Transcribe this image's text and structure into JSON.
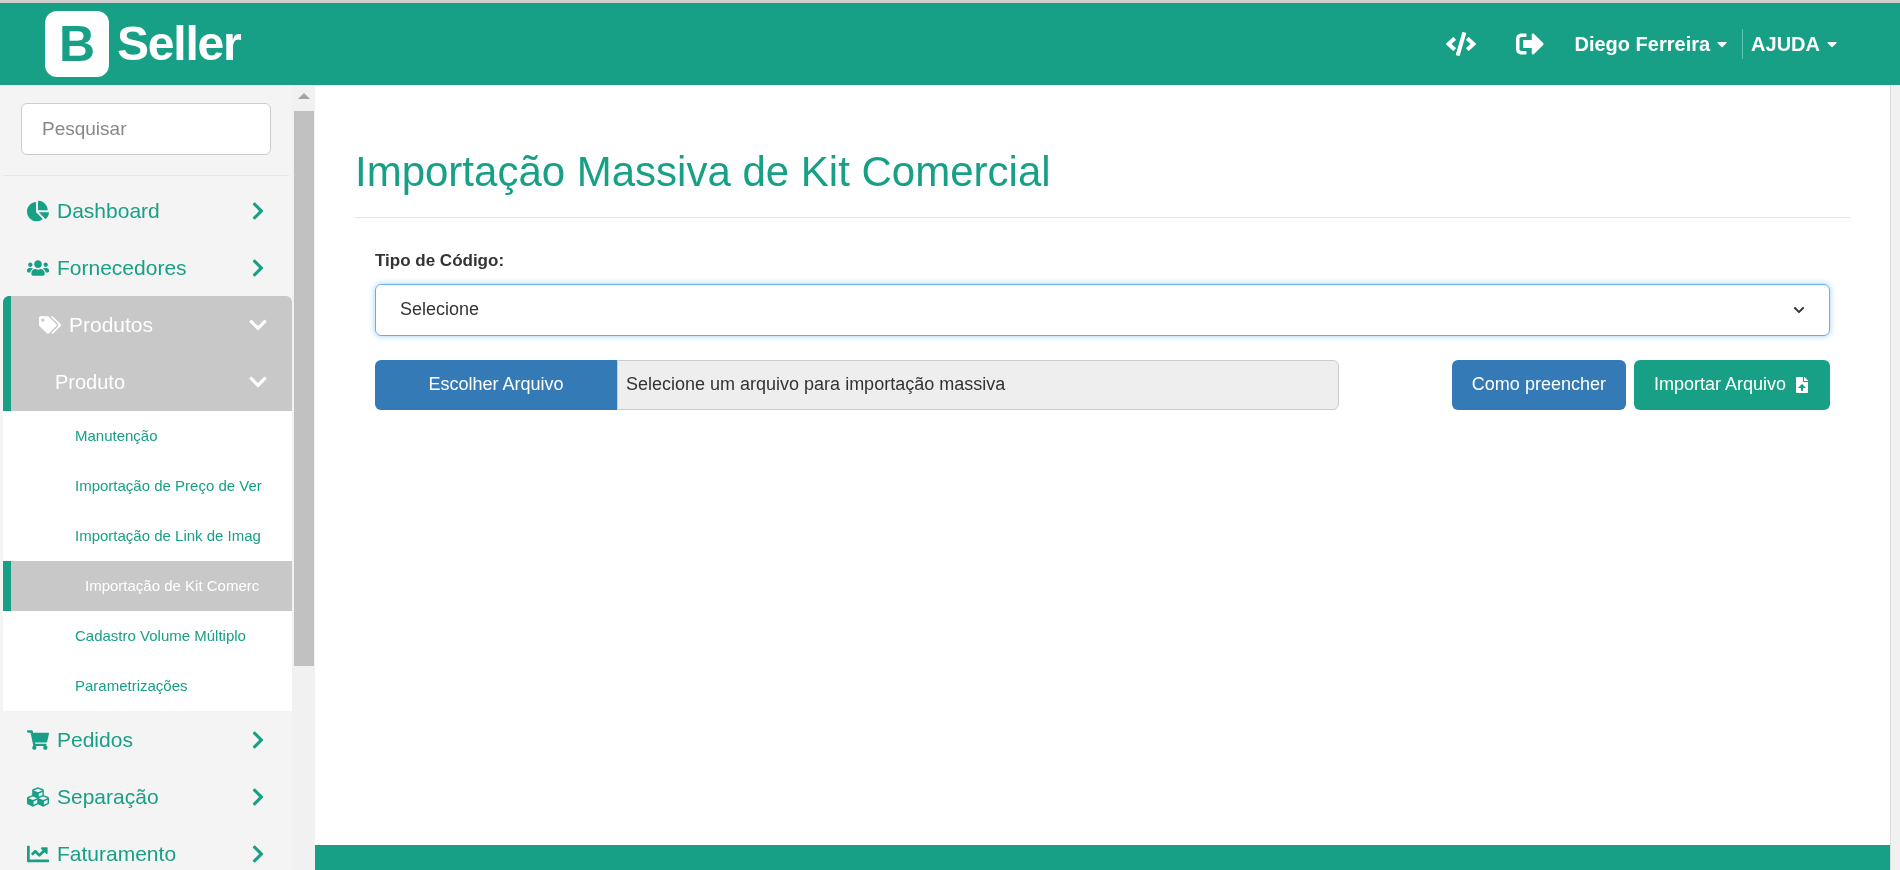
{
  "header": {
    "logo_mark": "B",
    "logo_text": "Seller",
    "user": "Diego Ferreira",
    "help": "AJUDA"
  },
  "sidebar": {
    "search": {
      "placeholder": "Pesquisar"
    },
    "items": [
      {
        "label": "Dashboard",
        "expanded": false
      },
      {
        "label": "Fornecedores",
        "expanded": false
      },
      {
        "label": "Produtos",
        "expanded": true,
        "children": [
          {
            "label": "Produto",
            "expanded": true,
            "children": [
              {
                "label": "Manutenção",
                "selected": false
              },
              {
                "label": "Importação de Preço de Ver",
                "selected": false
              },
              {
                "label": "Importação de Link de Imag",
                "selected": false
              },
              {
                "label": "Importação de Kit Comerc",
                "selected": true
              },
              {
                "label": "Cadastro Volume Múltiplo",
                "selected": false
              },
              {
                "label": "Parametrizações",
                "selected": false
              }
            ]
          }
        ]
      },
      {
        "label": "Pedidos",
        "expanded": false
      },
      {
        "label": "Separação",
        "expanded": false
      },
      {
        "label": "Faturamento",
        "expanded": false
      }
    ]
  },
  "main": {
    "title": "Importação Massiva de Kit Comercial",
    "code_type": {
      "label": "Tipo de Código:",
      "value": "Selecione"
    },
    "file": {
      "button": "Escolher Arquivo",
      "placeholder": "Selecione um arquivo para importação massiva"
    },
    "buttons": [
      {
        "label": "Como preencher",
        "kind": "info"
      },
      {
        "label": "Importar Arquivo",
        "kind": "import"
      }
    ]
  }
}
